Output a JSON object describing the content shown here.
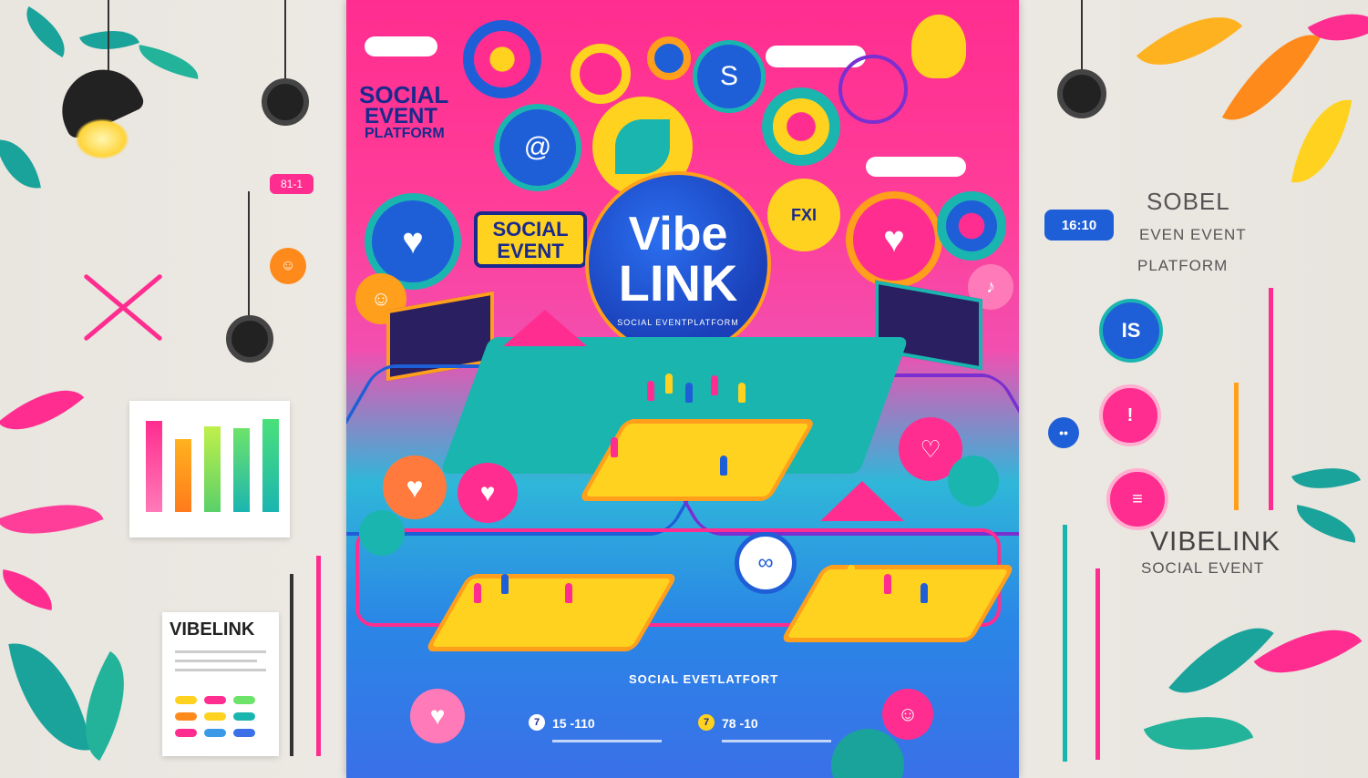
{
  "poster": {
    "brand_line1": "Vibe",
    "brand_line2": "LINK",
    "brand_tagline": "SOCIAL EVENTPLATFORM",
    "top_left_heading": [
      "SOCIAL",
      "EVENT",
      "PLATFORM"
    ],
    "social_event_badge": [
      "SOCIAL",
      "EVENT"
    ],
    "bottom_caption": "SOCIAL EVETLATFORT",
    "time_left": "15 -110",
    "time_right": "78 -10"
  },
  "right_panel": {
    "time_bubble": "16:10",
    "title": "SOBEL",
    "subtitle": "EVEN EVENT",
    "subtitle2": "PLATFORM",
    "brand": "VIBELINK",
    "brand_sub": "SOCIAL  EVENT"
  },
  "left_panel": {
    "small_tag": "81-1",
    "card_brand": "VIBELINK"
  },
  "colors": {
    "pink": "#ff2d8f",
    "blue": "#1e5fd8",
    "yellow": "#ffd21f",
    "teal": "#1bb5b0",
    "orange": "#ff9f1c"
  }
}
